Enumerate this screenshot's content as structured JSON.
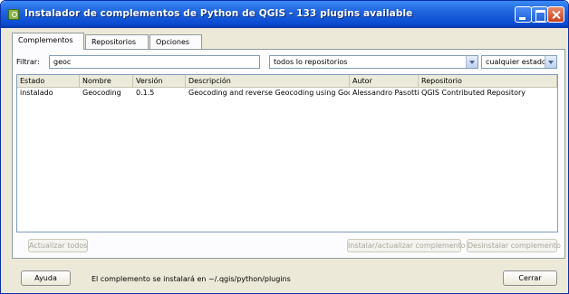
{
  "window": {
    "title": "Instalador de complementos de Python de QGIS - 133 plugins available"
  },
  "tabs": [
    {
      "label": "Complementos",
      "active": true
    },
    {
      "label": "Repositorios",
      "active": false
    },
    {
      "label": "Opciones",
      "active": false
    }
  ],
  "filter": {
    "label": "Filtrar:",
    "value": "geoc",
    "repository": "todos lo repositorios",
    "status": "cualquier estado"
  },
  "table": {
    "columns": [
      "Estado",
      "Nombre",
      "Versión",
      "Descripción",
      "Autor",
      "Repositorio"
    ],
    "rows": [
      [
        "instalado",
        "Geocoding",
        "0.1.5",
        "Geocoding and reverse Geocoding using Google",
        "Alessandro Pasotti",
        "QGIS Contributed Repository"
      ]
    ]
  },
  "actions": {
    "update_all": "Actualizar todos",
    "install": "Instalar/actualizar complemento",
    "uninstall": "Desinstalar complemento"
  },
  "footer": {
    "help": "Ayuda",
    "status": "El complemento se instalará en ~/.qgis/python/plugins",
    "close": "Cerrar"
  }
}
